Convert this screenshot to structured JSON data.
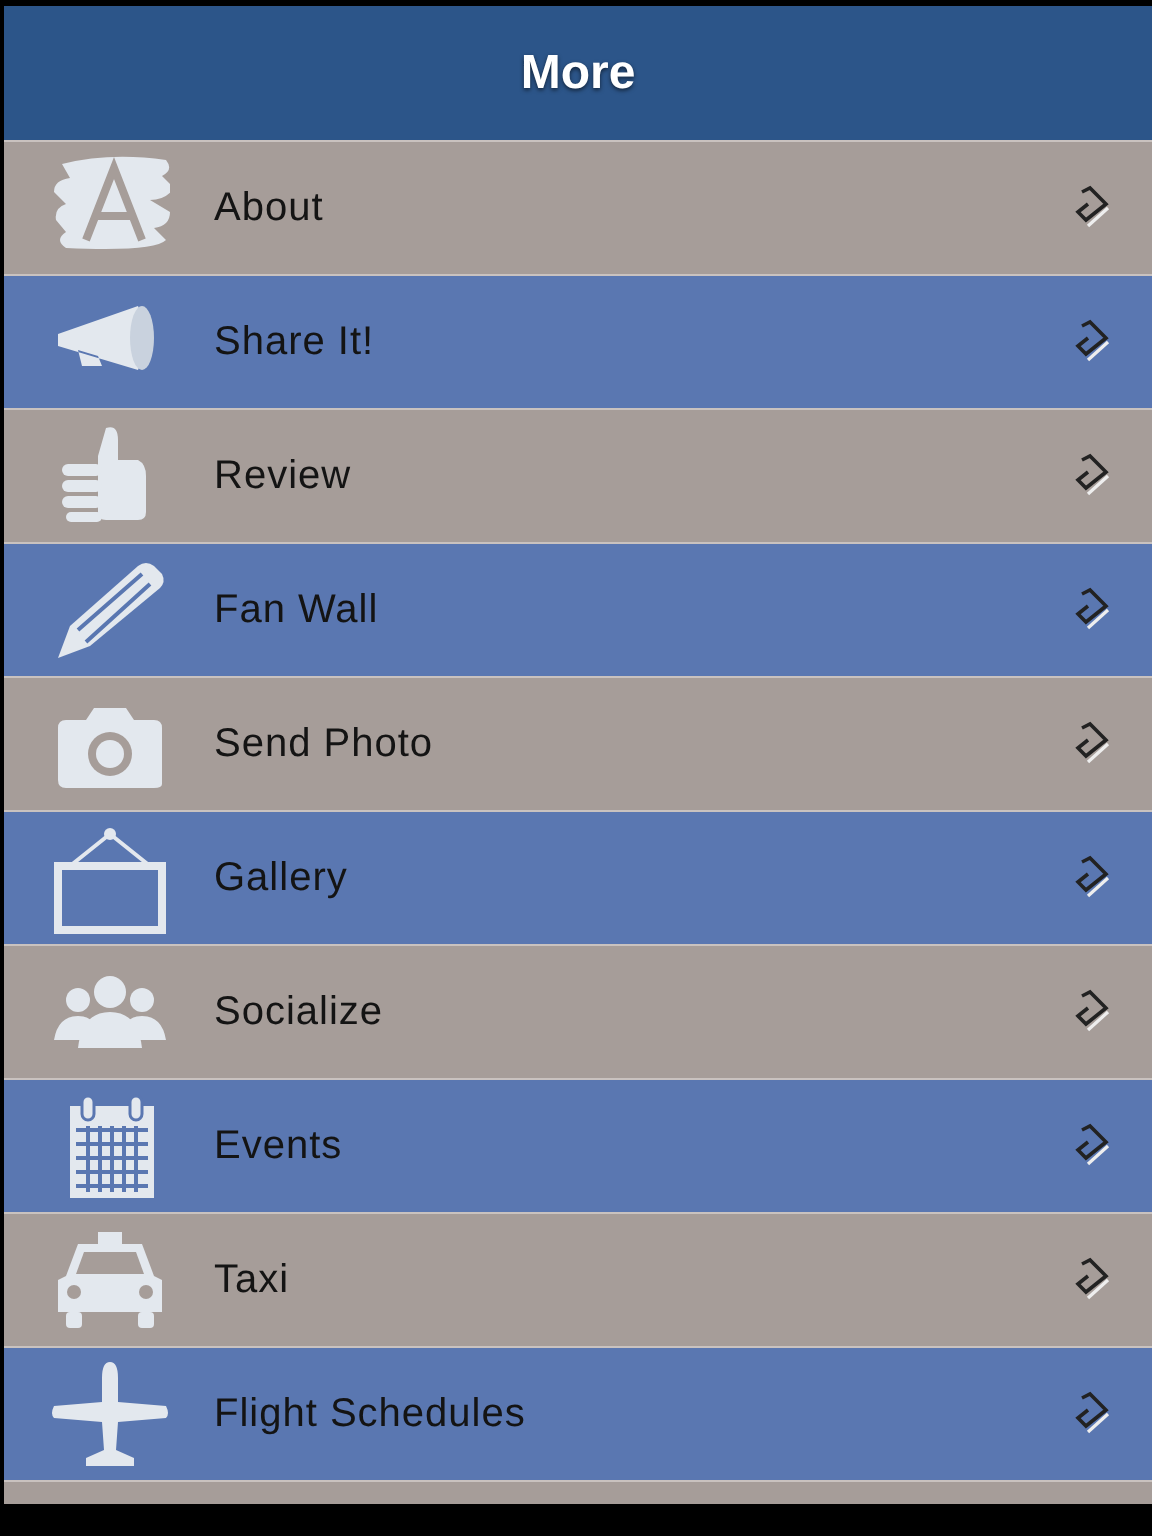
{
  "header": {
    "title": "More"
  },
  "items": [
    {
      "label": "About",
      "kind": "letter"
    },
    {
      "label": "Share It!",
      "kind": "megaphone"
    },
    {
      "label": "Review",
      "kind": "thumb"
    },
    {
      "label": "Fan Wall",
      "kind": "pencil"
    },
    {
      "label": "Send Photo",
      "kind": "camera"
    },
    {
      "label": "Gallery",
      "kind": "frame"
    },
    {
      "label": "Socialize",
      "kind": "people"
    },
    {
      "label": "Events",
      "kind": "calendar"
    },
    {
      "label": "Taxi",
      "kind": "taxi"
    },
    {
      "label": "Flight Schedules",
      "kind": "plane"
    }
  ]
}
